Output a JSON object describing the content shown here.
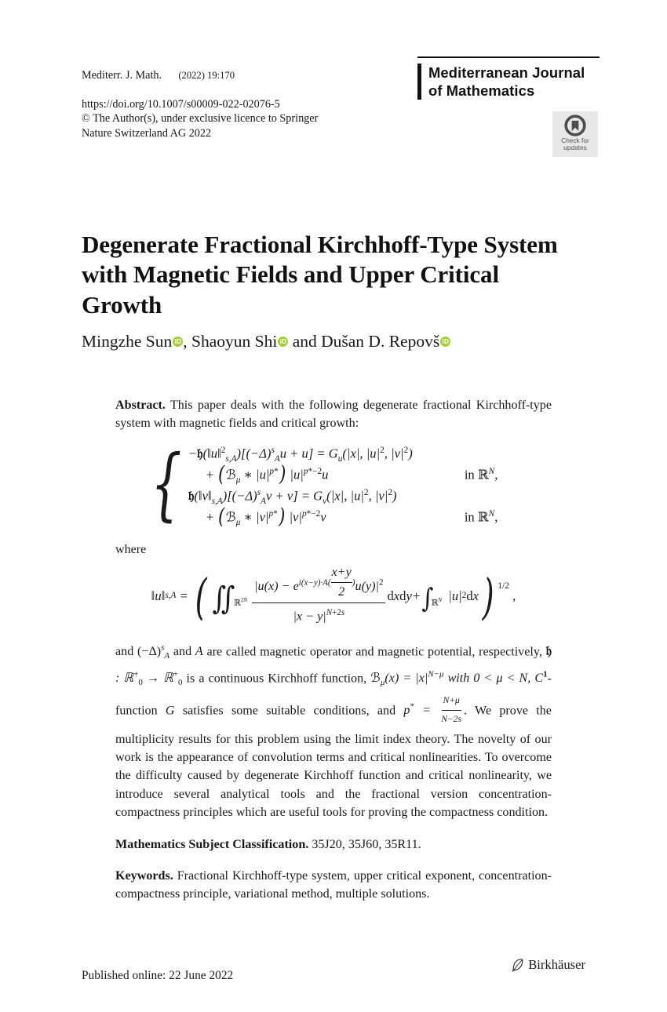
{
  "header": {
    "journal_short": "Mediterr. J. Math.",
    "issue": "(2022) 19:170",
    "doi": "https://doi.org/10.1007/s00009-022-02076-5",
    "copyright": "© The Author(s), under exclusive licence to Springer\nNature Switzerland AG 2022",
    "journal_full_name": "Mediterranean Journal\nof Mathematics",
    "check_updates_label": "Check for\nupdates"
  },
  "article": {
    "title": "Degenerate Fractional Kirchhoff-Type System with Magnetic Fields and Upper Critical Growth",
    "authors_prefix": "Mingzhe Sun",
    "author2": ", Shaoyun Shi",
    "author3": " and Dušan D. Repovš",
    "authors_full": "Mingzhe Sun, Shaoyun Shi and Dušan D. Repovš"
  },
  "abstract": {
    "label": "Abstract.",
    "intro": "This paper deals with the following degenerate fractional Kirchhoff-type system with magnetic fields and critical growth:",
    "where_label": "where",
    "body_continued": "are called magnetic operator and magnetic potential, respectively,",
    "tail_1": "is a continuous Kirchhoff function,",
    "tail_2": "-function",
    "tail_3": "satisfies some suitable conditions, and",
    "tail_4": ". We prove the multiplicity results for this problem using the limit index theory. The novelty of our work is the appearance of convolution terms and critical nonlinearities. To overcome the difficulty caused by degenerate Kirchhoff function and critical nonlinearity, we introduce several analytical tools and the fractional version concentration-compactness principles which are useful tools for proving the compactness condition."
  },
  "equations": {
    "system": {
      "row1_body": "−𝔐(‖u‖²s,A)[(−Δ)sAu + u] = Gu(|x|, |u|², |v|²)",
      "row2_body": "+ (ℐμ ∗ |u|p*) |u|p*−2u",
      "row2_cond": "in ℝN,",
      "row3_body": "𝔐(‖v‖s,A)[(−Δ)sAv + v] = Gv(|x|, |u|², |v|²)",
      "row4_body": "+ (ℐμ ∗ |v|p*) |v|p*−2v",
      "row4_cond": "in ℝN,"
    },
    "norm": "‖u‖s,A = ( ∬ℝ2N |u(x) − ei(x−y)·A((x+y)/2)u(y)|² / |x−y|N+2s dxdy + ∫ℝN |u|²dx )1/2 ,"
  },
  "msc": {
    "label": "Mathematics Subject Classification.",
    "codes": "35J20, 35J60, 35R11."
  },
  "keywords": {
    "label": "Keywords.",
    "text": "Fractional Kirchhoff-type system, upper critical exponent, concentration-compactness principle, variational method, multiple solutions."
  },
  "footer": {
    "published": "Published online: 22 June 2022",
    "publisher": "Birkhäuser"
  },
  "colors": {
    "orcid_green": "#a6ce39",
    "badge_background": "#e8e8e8",
    "text": "#1a1a1a"
  }
}
